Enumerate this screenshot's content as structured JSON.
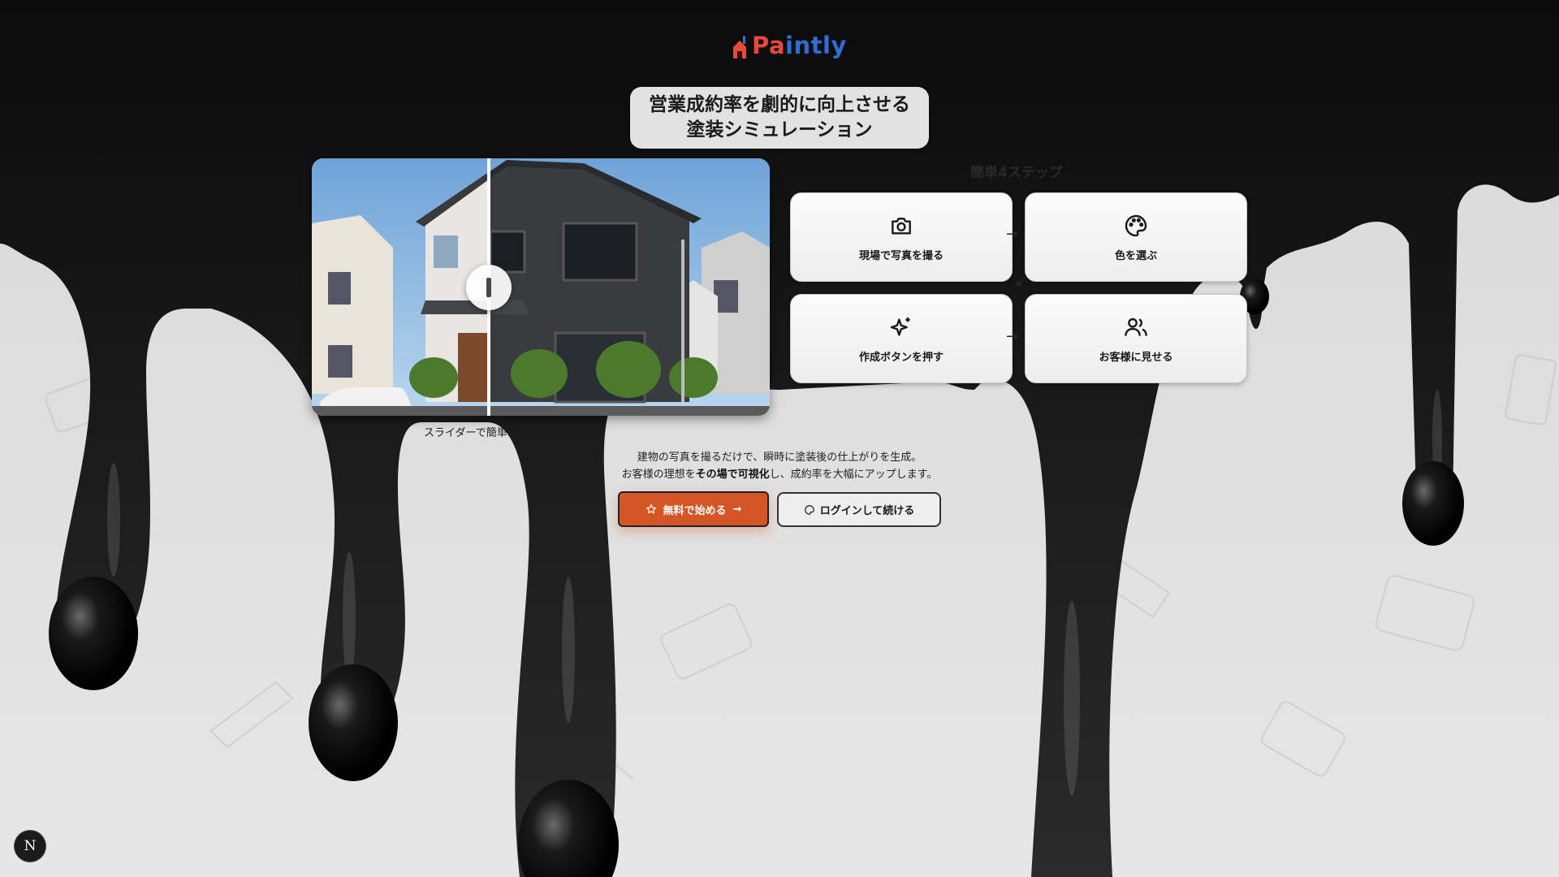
{
  "brand": {
    "logo_text_prefix": "Pa",
    "logo_text_suffix": "intly",
    "logo_name": "Paintly"
  },
  "headline": {
    "line1": "営業成約率を劇的に向上させる",
    "line2": "塗装シミュレーション"
  },
  "compare": {
    "caption": "スライダーで簡単に比較できます",
    "split_fraction": 0.39
  },
  "steps": {
    "title": "簡単4ステップ",
    "items": [
      {
        "icon": "camera-icon",
        "label": "現場で写真を撮る"
      },
      {
        "icon": "palette-icon",
        "label": "色を選ぶ"
      },
      {
        "icon": "sparkles-icon",
        "label": "作成ボタンを押す"
      },
      {
        "icon": "users-icon",
        "label": "お客様に見せる"
      }
    ]
  },
  "description": {
    "line1": "建物の写真を撮るだけで、瞬時に塗装後の仕上がりを生成。",
    "line2_pre": "お客様の理想を",
    "line2_bold": "その場で可視化",
    "line2_post": "し、成約率を大幅にアップします。"
  },
  "buttons": {
    "start_label": "無料で始める",
    "login_label": "ログインして続ける"
  },
  "badge": {
    "letter": "N"
  },
  "colors": {
    "accent": "#d45525",
    "logo_blue": "#2f6cd4",
    "logo_red": "#e8483a"
  }
}
